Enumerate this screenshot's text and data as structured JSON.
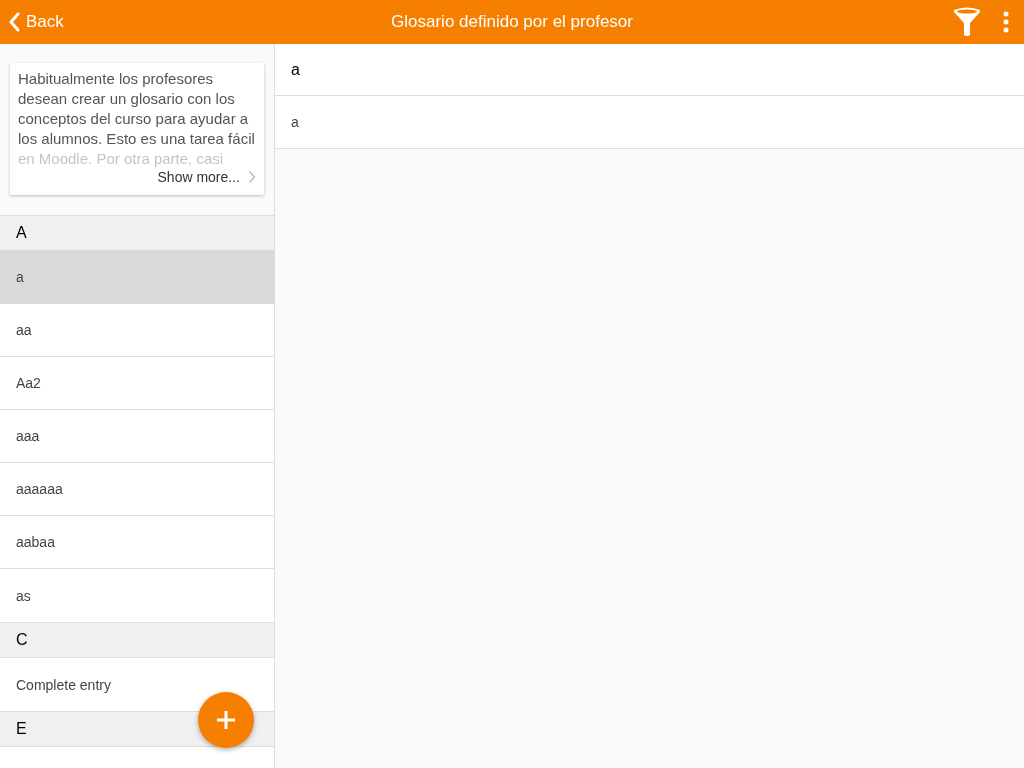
{
  "header": {
    "back": "Back",
    "title": "Glosario definido por el profesor"
  },
  "intro": {
    "text": "Habitualmente los profesores desean crear un glosario con los conceptos del curso para ayudar a los alumnos. Esto es una tarea fácil en Moodle. Por otra parte, casi",
    "more": "Show more..."
  },
  "groups": [
    {
      "letter": "A",
      "entries": [
        {
          "term": "a",
          "selected": true
        },
        {
          "term": "aa",
          "selected": false
        },
        {
          "term": "Aa2",
          "selected": false
        },
        {
          "term": "aaa",
          "selected": false
        },
        {
          "term": "aaaaaa",
          "selected": false
        },
        {
          "term": "aabaa",
          "selected": false
        },
        {
          "term": "as",
          "selected": false
        }
      ]
    },
    {
      "letter": "C",
      "entries": [
        {
          "term": "Complete entry",
          "selected": false
        }
      ]
    },
    {
      "letter": "E"
    }
  ],
  "detail": {
    "concept": "a",
    "definition": "a"
  }
}
